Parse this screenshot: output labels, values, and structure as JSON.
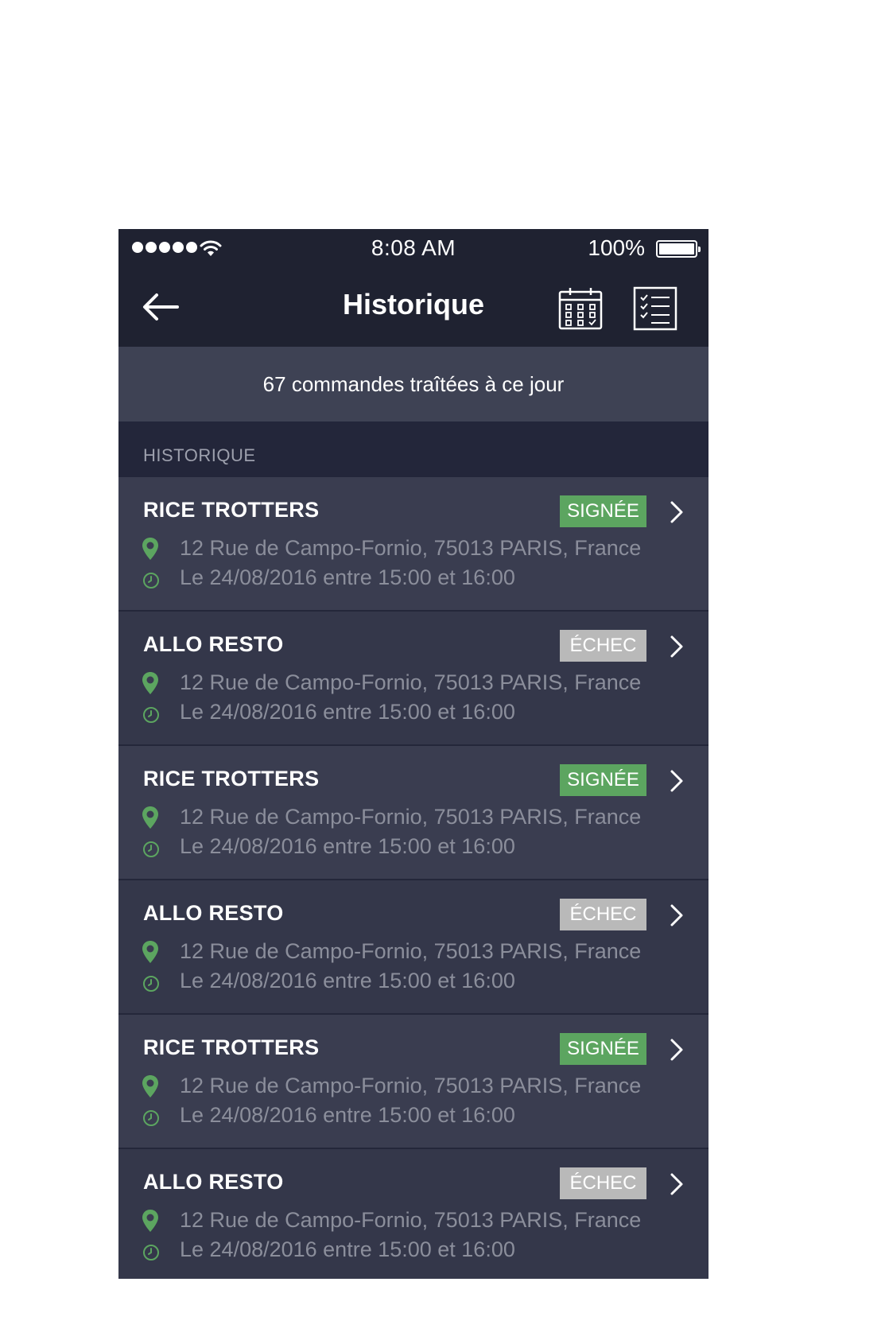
{
  "status_bar": {
    "time": "8:08 AM",
    "battery": "100%"
  },
  "nav": {
    "title": "Historique",
    "icons": [
      "back-arrow-icon",
      "calendar-icon",
      "checklist-icon"
    ]
  },
  "summary": {
    "text": "67 commandes traîtées à ce jour"
  },
  "section": {
    "title": "HISTORIQUE"
  },
  "colors": {
    "accent_green": "#5ca560",
    "fail_gray": "#b9b9b9",
    "header_bg": "#1f2231",
    "row_bg": "#3a3d50"
  },
  "orders": [
    {
      "name": "RICE TROTTERS",
      "status": "SIGNÉE",
      "address": "12 Rue de Campo-Fornio, 75013 PARIS, France",
      "time": "Le 24/08/2016 entre 15:00 et 16:00"
    },
    {
      "name": "ALLO RESTO",
      "status": "ÉCHEC",
      "address": "12 Rue de Campo-Fornio, 75013 PARIS, France",
      "time": "Le 24/08/2016 entre 15:00 et 16:00"
    },
    {
      "name": "RICE TROTTERS",
      "status": "SIGNÉE",
      "address": "12 Rue de Campo-Fornio, 75013 PARIS, France",
      "time": "Le 24/08/2016 entre 15:00 et 16:00"
    },
    {
      "name": "ALLO RESTO",
      "status": "ÉCHEC",
      "address": "12 Rue de Campo-Fornio, 75013 PARIS, France",
      "time": "Le 24/08/2016 entre 15:00 et 16:00"
    },
    {
      "name": "RICE TROTTERS",
      "status": "SIGNÉE",
      "address": "12 Rue de Campo-Fornio, 75013 PARIS, France",
      "time": "Le 24/08/2016 entre 15:00 et 16:00"
    },
    {
      "name": "ALLO RESTO",
      "status": "ÉCHEC",
      "address": "12 Rue de Campo-Fornio, 75013 PARIS, France",
      "time": "Le 24/08/2016 entre 15:00 et 16:00"
    }
  ]
}
